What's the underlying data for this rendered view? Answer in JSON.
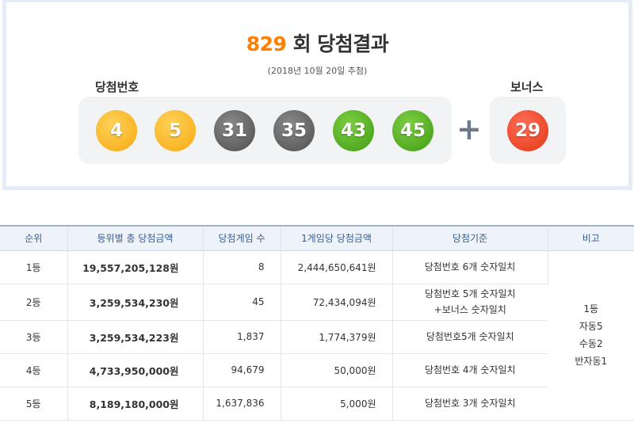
{
  "result": {
    "round": "829",
    "title_suffix": "회 당첨결과",
    "draw_date": "(2018년 10월 20일 추첨)",
    "main_label": "당첨번호",
    "bonus_label": "보너스",
    "plus_symbol": "+",
    "numbers": [
      "4",
      "5",
      "31",
      "35",
      "43",
      "45"
    ],
    "bonus_number": "29",
    "ball_colors": {
      "yellow": "#f6a80e",
      "gray": "#4e4e4e",
      "green": "#3e9a12",
      "red": "#e23614"
    }
  },
  "table": {
    "headers": [
      "순위",
      "등위별 총 당첨금액",
      "당첨게임 수",
      "1게임당 당첨금액",
      "당첨기준",
      "비고"
    ],
    "rows": [
      {
        "rank": "1등",
        "total": "19,557,205,128원",
        "count": "8",
        "per_game": "2,444,650,641원",
        "criteria": "당첨번호 6개 숫자일치",
        "criteria2": ""
      },
      {
        "rank": "2등",
        "total": "3,259,534,230원",
        "count": "45",
        "per_game": "72,434,094원",
        "criteria": "당첨번호 5개 숫자일치",
        "criteria2": "+보너스 숫자일치"
      },
      {
        "rank": "3등",
        "total": "3,259,534,223원",
        "count": "1,837",
        "per_game": "1,774,379원",
        "criteria": "당첨번호5개 숫자일치",
        "criteria2": ""
      },
      {
        "rank": "4등",
        "total": "4,733,950,000원",
        "count": "94,679",
        "per_game": "50,000원",
        "criteria": "당첨번호 4개 숫자일치",
        "criteria2": ""
      },
      {
        "rank": "5등",
        "total": "8,189,180,000원",
        "count": "1,637,836",
        "per_game": "5,000원",
        "criteria": "당첨번호 3개 숫자일치",
        "criteria2": ""
      }
    ],
    "note_lines": [
      "1등",
      "자동5",
      "수동2",
      "반자동1"
    ]
  }
}
